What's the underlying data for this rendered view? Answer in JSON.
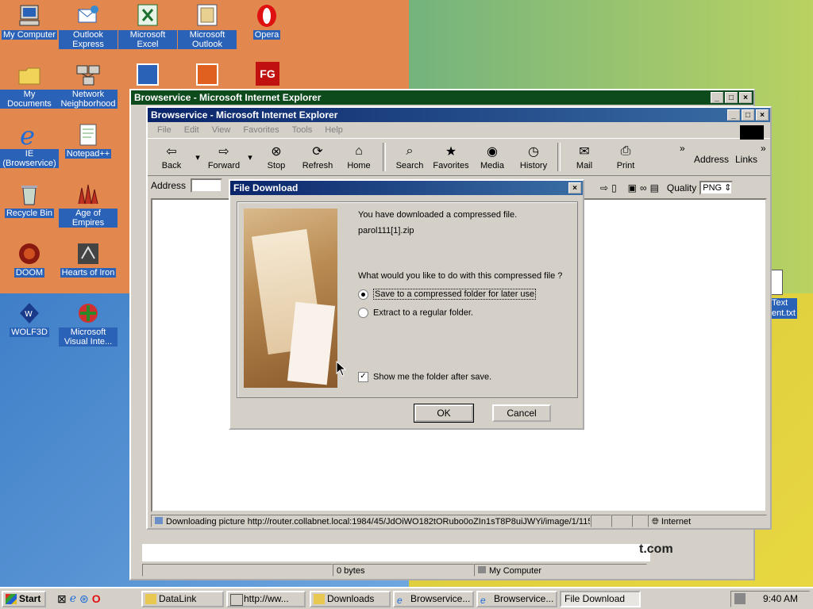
{
  "desktop": {
    "icons": [
      {
        "label": "My Computer"
      },
      {
        "label": "Outlook Express"
      },
      {
        "label": "Microsoft Excel"
      },
      {
        "label": "Microsoft Outlook"
      },
      {
        "label": "Opera"
      },
      {
        "label": "My Documents"
      },
      {
        "label": "Network Neighborhood"
      },
      {
        "label": "IE (Browservice)"
      },
      {
        "label": "Notepad++"
      },
      {
        "label": "Recycle Bin"
      },
      {
        "label": "Age of Empires"
      },
      {
        "label": "DOOM"
      },
      {
        "label": "Hearts of Iron"
      },
      {
        "label": "WOLF3D"
      },
      {
        "label": "Microsoft Visual Inte..."
      },
      {
        "label": "Text"
      },
      {
        "label": "ent.txt"
      },
      {
        "label": "t.com"
      }
    ]
  },
  "back_window": {
    "title": "Browservice - Microsoft Internet Explorer",
    "status_bytes": "0 bytes",
    "status_zone": "My Computer"
  },
  "ie_window": {
    "title": "Browservice - Microsoft Internet Explorer",
    "menu": [
      "File",
      "Edit",
      "View",
      "Favorites",
      "Tools",
      "Help"
    ],
    "toolbar": [
      "Back",
      "Forward",
      "Stop",
      "Refresh",
      "Home",
      "Search",
      "Favorites",
      "Media",
      "History",
      "Mail",
      "Print"
    ],
    "address_label": "Address",
    "links_label": "Links",
    "addressbar_label": "Address",
    "quality_label": "Quality",
    "quality_value": "PNG",
    "status_text": "Downloading picture http://router.collabnet.local:1984/45/JdOiWO182tORubo0oZIn1sT8P8uiJWYi/image/1/115",
    "status_zone": "Internet"
  },
  "dialog": {
    "title": "File Download",
    "line1": "You have downloaded a compressed file.",
    "filename": "parol111[1].zip",
    "question": "What would you like to do with this compressed file ?",
    "option1": "Save to a compressed folder for later use",
    "option2": "Extract to a regular folder.",
    "checkbox": "Show me the folder after save.",
    "ok": "OK",
    "cancel": "Cancel"
  },
  "taskbar": {
    "start": "Start",
    "tasks": [
      "DataLink",
      "http://ww...",
      "Downloads",
      "Browservice...",
      "Browservice...",
      "File Download"
    ],
    "clock": "9:40 AM"
  },
  "colors": {
    "title_active": "#0a246a",
    "title_inactive": "#0d4a1c",
    "face": "#d4d0c8"
  }
}
